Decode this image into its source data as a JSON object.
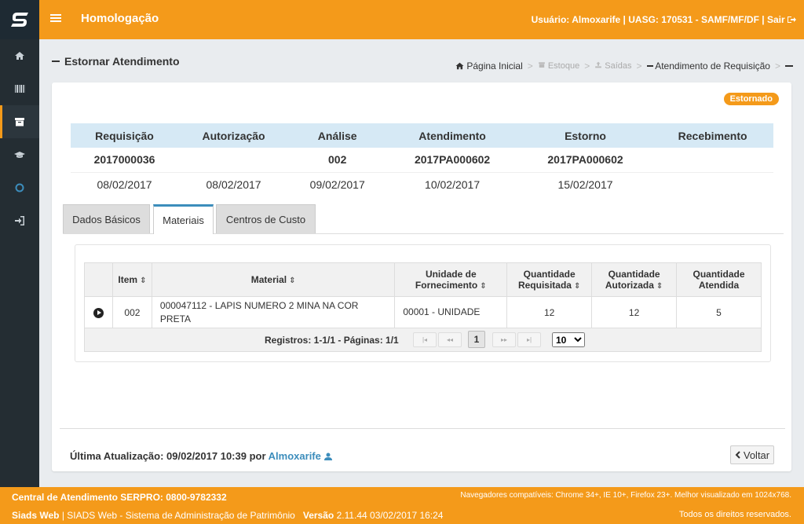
{
  "header": {
    "title": "Homologação",
    "user_label": "Usuário: Almoxarife | UASG: 170531 - SAMF/MF/DF |",
    "logout_label": "Sair"
  },
  "sidebar": {
    "items": [
      {
        "icon": "home-icon"
      },
      {
        "icon": "barcode-icon"
      },
      {
        "icon": "archive-icon"
      },
      {
        "icon": "graduation-cap-icon"
      },
      {
        "icon": "circle-icon"
      },
      {
        "icon": "sign-in-icon"
      }
    ]
  },
  "page": {
    "title": "Estornar Atendimento",
    "breadcrumb": {
      "home": "Página Inicial",
      "estoque": "Estoque",
      "saidas": "Saídas",
      "current": "Atendimento de Requisição"
    },
    "badge": "Estornado"
  },
  "stages": {
    "headers": [
      "Requisição",
      "Autorização",
      "Análise",
      "Atendimento",
      "Estorno",
      "Recebimento"
    ],
    "codes": [
      "2017000036",
      "",
      "002",
      "2017PA000602",
      "2017PA000602",
      ""
    ],
    "dates": [
      "08/02/2017",
      "08/02/2017",
      "09/02/2017",
      "10/02/2017",
      "15/02/2017",
      ""
    ]
  },
  "tabs": [
    "Dados Básicos",
    "Materiais",
    "Centros de Custo"
  ],
  "materials": {
    "headers": {
      "item": "Item",
      "material": "Material",
      "unidade_1": "Unidade de",
      "unidade_2": "Fornecimento",
      "qreq_1": "Quantidade",
      "qreq_2": "Requisitada",
      "qaut_1": "Quantidade",
      "qaut_2": "Autorizada",
      "qate_1": "Quantidade",
      "qate_2": "Atendida"
    },
    "rows": [
      {
        "item": "002",
        "material_1": "000047112 - LAPIS NUMERO 2 MINA NA COR",
        "material_2": "PRETA",
        "unidade": "00001 - UNIDADE",
        "requisitada": "12",
        "autorizada": "12",
        "atendida": "5"
      }
    ],
    "pager": {
      "records": "Registros: 1-1/1 - Páginas: 1/1",
      "current_page": "1",
      "page_size": "10"
    }
  },
  "footer_card": {
    "last_update_label": "Última Atualização: 09/02/2017 10:39 por",
    "last_update_user": "Almoxarife",
    "back_label": "Voltar"
  },
  "footer": {
    "central": "Central de Atendimento SERPRO: 0800-9782332",
    "browsers": "Navegadores compatíveis: Chrome 34+, IE 10+, Firefox 23+. Melhor visualizado em 1024x768.",
    "siads_bold": "Siads Web",
    "siads_text": "| SIADS Web - Sistema de Administração de Patrimônio",
    "version_label": "Versão",
    "version_value": "2.11.44 03/02/2017 16:24",
    "rights": "Todos os direitos reservados."
  },
  "colors": {
    "brand": "#f49a1a",
    "sidebar": "#242d33",
    "accent": "#3c8dbc"
  }
}
